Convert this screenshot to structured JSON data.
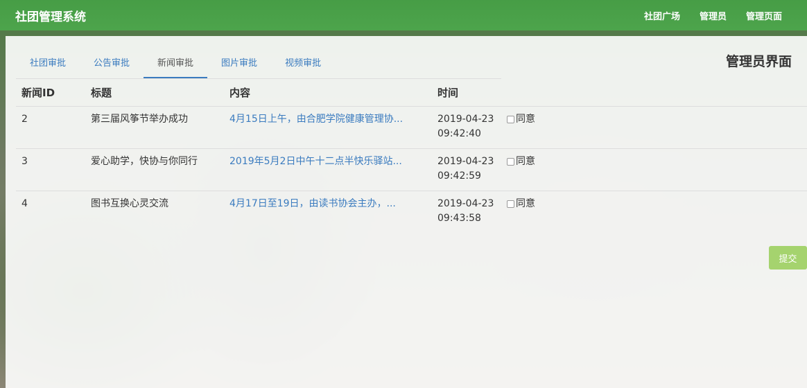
{
  "navbar": {
    "brand": "社团管理系统",
    "links": [
      "社团广场",
      "管理员",
      "管理页面"
    ]
  },
  "tabs": [
    "社团审批",
    "公告审批",
    "新闻审批",
    "图片审批",
    "视频审批"
  ],
  "active_tab": "新闻审批",
  "page_heading": "管理员界面",
  "table": {
    "headers": [
      "新闻ID",
      "标题",
      "内容",
      "时间"
    ],
    "rows": [
      {
        "id": "2",
        "title": "第三届风筝节举办成功",
        "content": "4月15日上午，由合肥学院健康管理协...",
        "date": "2019-04-23",
        "time": "09:42:40",
        "agree_label": "同意"
      },
      {
        "id": "3",
        "title": "爱心助学，快协与你同行",
        "content": "2019年5月2日中午十二点半快乐驿站...",
        "date": "2019-04-23",
        "time": "09:42:59",
        "agree_label": "同意"
      },
      {
        "id": "4",
        "title": "图书互换心灵交流",
        "content": "4月17日至19日，由读书协会主办，...",
        "date": "2019-04-23",
        "time": "09:43:58",
        "agree_label": "同意"
      }
    ]
  },
  "submit_label": "提交",
  "colors": {
    "navbar": "#4caa4c",
    "link": "#3a7bbf",
    "submit": "#a5d36e"
  }
}
